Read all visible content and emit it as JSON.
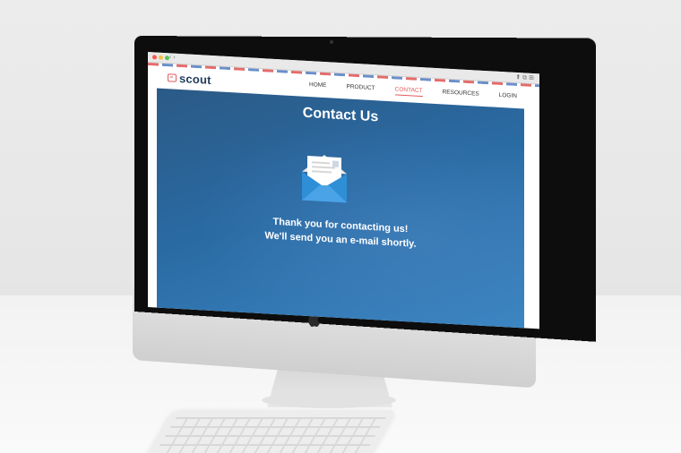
{
  "browser": {
    "nav_arrows": "‹ ›",
    "actions": "⬆ ⧉ ⊞"
  },
  "site": {
    "logo_text": "scout",
    "nav": [
      {
        "label": "HOME"
      },
      {
        "label": "PRODUCT"
      },
      {
        "label": "CONTACT"
      },
      {
        "label": "RESOURCES"
      },
      {
        "label": "LOGIN"
      }
    ],
    "active_nav": "CONTACT"
  },
  "hero": {
    "title": "Contact Us",
    "message_line1": "Thank you for contacting us!",
    "message_line2": "We'll send you an e-mail shortly."
  },
  "device": {
    "logo": "apple-logo-icon"
  },
  "colors": {
    "brand_red": "#e25a5a",
    "brand_navy": "#1f3b5b",
    "hero_blue": "#2a6aa3",
    "envelope_blue": "#2f8fd6"
  }
}
